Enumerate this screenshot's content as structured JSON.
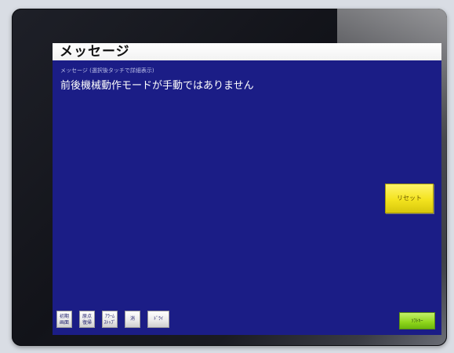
{
  "screen": {
    "title": "メッセージ",
    "subtitle": "メッセージ (選択後タッチで詳細表示)",
    "message": "前後機械動作モードが手動ではありません"
  },
  "buttons": {
    "reset": "リセット",
    "next": "ｿﾌﾄｷｰ"
  },
  "softkeys": [
    {
      "label": "初期\n画面"
    },
    {
      "label": "原点\n復帰"
    },
    {
      "label": "ｱﾗｰﾑ\nｽﾄｯﾌﾟ"
    },
    {
      "label": "消"
    },
    {
      "label": "ﾄﾞﾗｲ"
    }
  ],
  "colors": {
    "screen_bg": "#1b1d86",
    "reset_button": "#f3e31e",
    "next_button": "#8fd61b"
  }
}
